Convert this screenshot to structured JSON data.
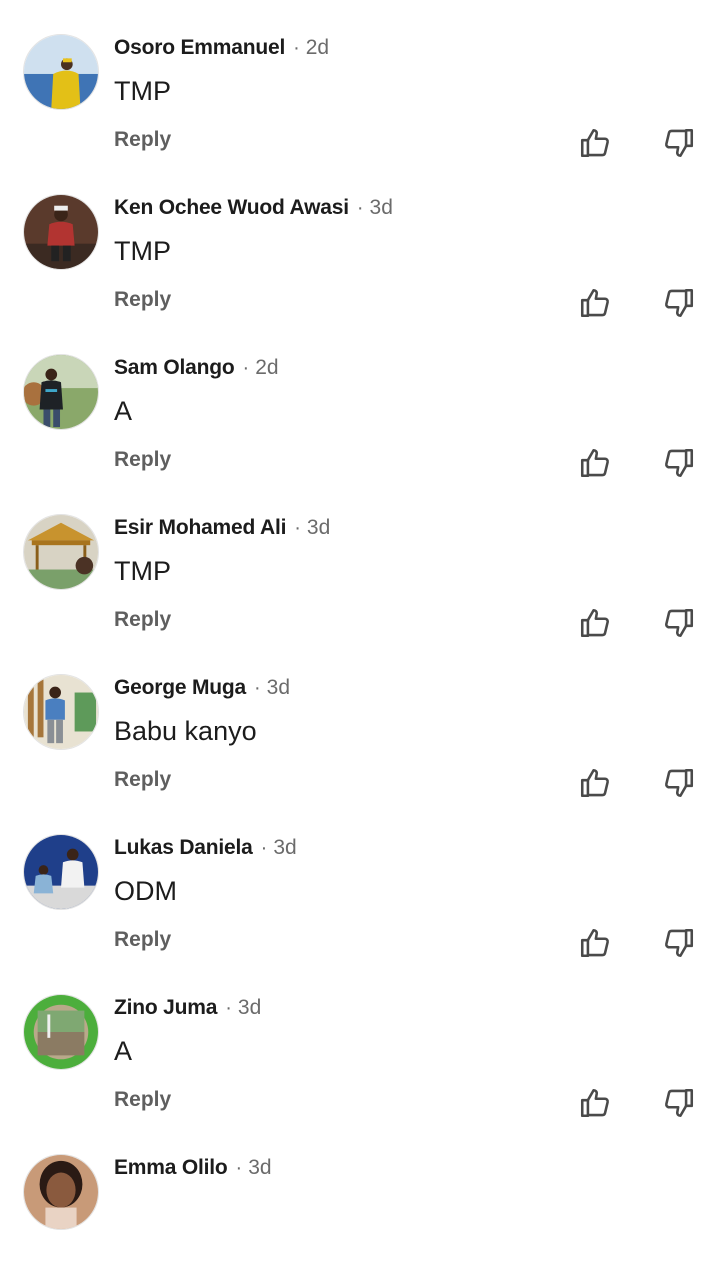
{
  "comments": [
    {
      "author": "Osoro Emmanuel",
      "time": "2d",
      "text": "TMP",
      "reply_label": "Reply",
      "avatar": "person-yellow-jacket-avatar"
    },
    {
      "author": "Ken Ochee Wuod Awasi",
      "time": "3d",
      "text": "TMP",
      "reply_label": "Reply",
      "avatar": "person-red-shirt-avatar"
    },
    {
      "author": "Sam Olango",
      "time": "2d",
      "text": "A",
      "reply_label": "Reply",
      "avatar": "person-outdoor-avatar"
    },
    {
      "author": "Esir Mohamed Ali",
      "time": "3d",
      "text": "TMP",
      "reply_label": "Reply",
      "avatar": "gazebo-avatar"
    },
    {
      "author": "George Muga",
      "time": "3d",
      "text": "Babu kanyo",
      "reply_label": "Reply",
      "avatar": "person-blue-shirt-avatar"
    },
    {
      "author": "Lukas Daniela",
      "time": "3d",
      "text": "ODM",
      "reply_label": "Reply",
      "avatar": "two-people-blue-wall-avatar"
    },
    {
      "author": "Zino Juma",
      "time": "3d",
      "text": "A",
      "reply_label": "Reply",
      "avatar": "green-frame-avatar"
    },
    {
      "author": "Emma Olilo",
      "time": "3d",
      "text": "",
      "reply_label": "",
      "avatar": "woman-portrait-avatar"
    }
  ],
  "separator": "·",
  "icons": {
    "like": "thumbs-up-icon",
    "dislike": "thumbs-down-icon"
  },
  "colors": {
    "text": "#1c1c1c",
    "muted": "#6b6b6b",
    "icon": "#4a4a4a",
    "background": "#ffffff"
  }
}
